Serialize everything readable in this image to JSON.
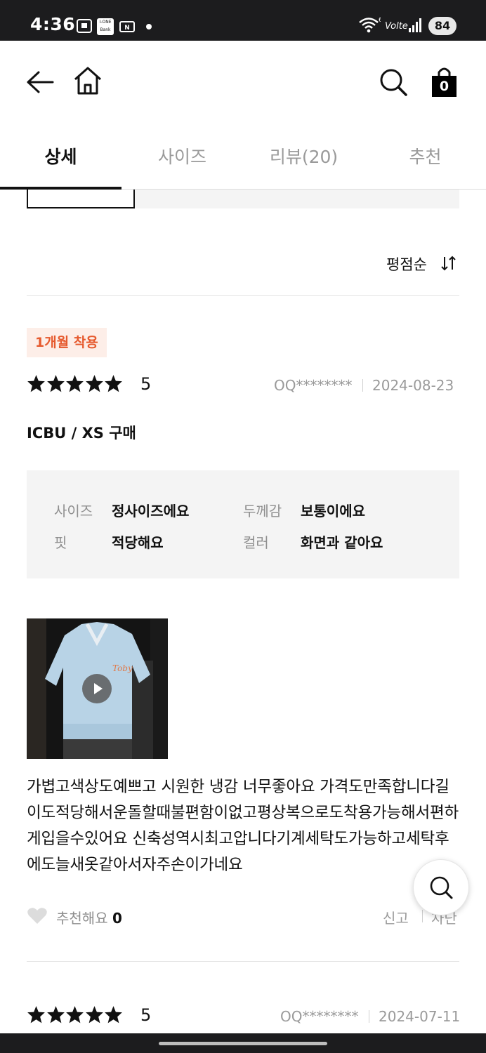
{
  "status_bar": {
    "time": "4:36",
    "battery": "84",
    "network": "Volte",
    "bank_badge": "I-ONE Bank"
  },
  "header": {
    "cart_count": "0"
  },
  "tabs": [
    {
      "label": "상세",
      "active": true
    },
    {
      "label": "사이즈",
      "active": false
    },
    {
      "label": "리뷰(20)",
      "active": false
    },
    {
      "label": "추천",
      "active": false
    }
  ],
  "sort": {
    "label": "평점순"
  },
  "review1": {
    "tag": "1개월 착용",
    "rating": "5",
    "stars": 5,
    "user": "OQ********",
    "date": "2024-08-23",
    "purchase": "ICBU / XS 구매",
    "specs": {
      "size_label": "사이즈",
      "size_value": "정사이즈에요",
      "thickness_label": "두께감",
      "thickness_value": "보통이에요",
      "fit_label": "핏",
      "fit_value": "적당해요",
      "color_label": "컬러",
      "color_value": "화면과 같아요"
    },
    "body": "가볍고색상도예쁘고 시원한 냉감 너무좋아요 가격도만족합니다길이도적당해서운돌할때불편함이없고평상복으로도착용가능해서편하게입을수있어요 신축성역시최고압니다기계세탁도가능하고세탁후에도늘새옷같아서자주손이가네요",
    "helpful_label": "추천해요",
    "helpful_count": "0",
    "report_label": "신고",
    "delete_label": "차단"
  },
  "review2": {
    "rating": "5",
    "stars": 5,
    "user": "OQ********",
    "date": "2024-07-11"
  },
  "colors": {
    "tag_bg": "#fdeee8",
    "tag_text": "#e65a2e",
    "accent": "#111111"
  }
}
